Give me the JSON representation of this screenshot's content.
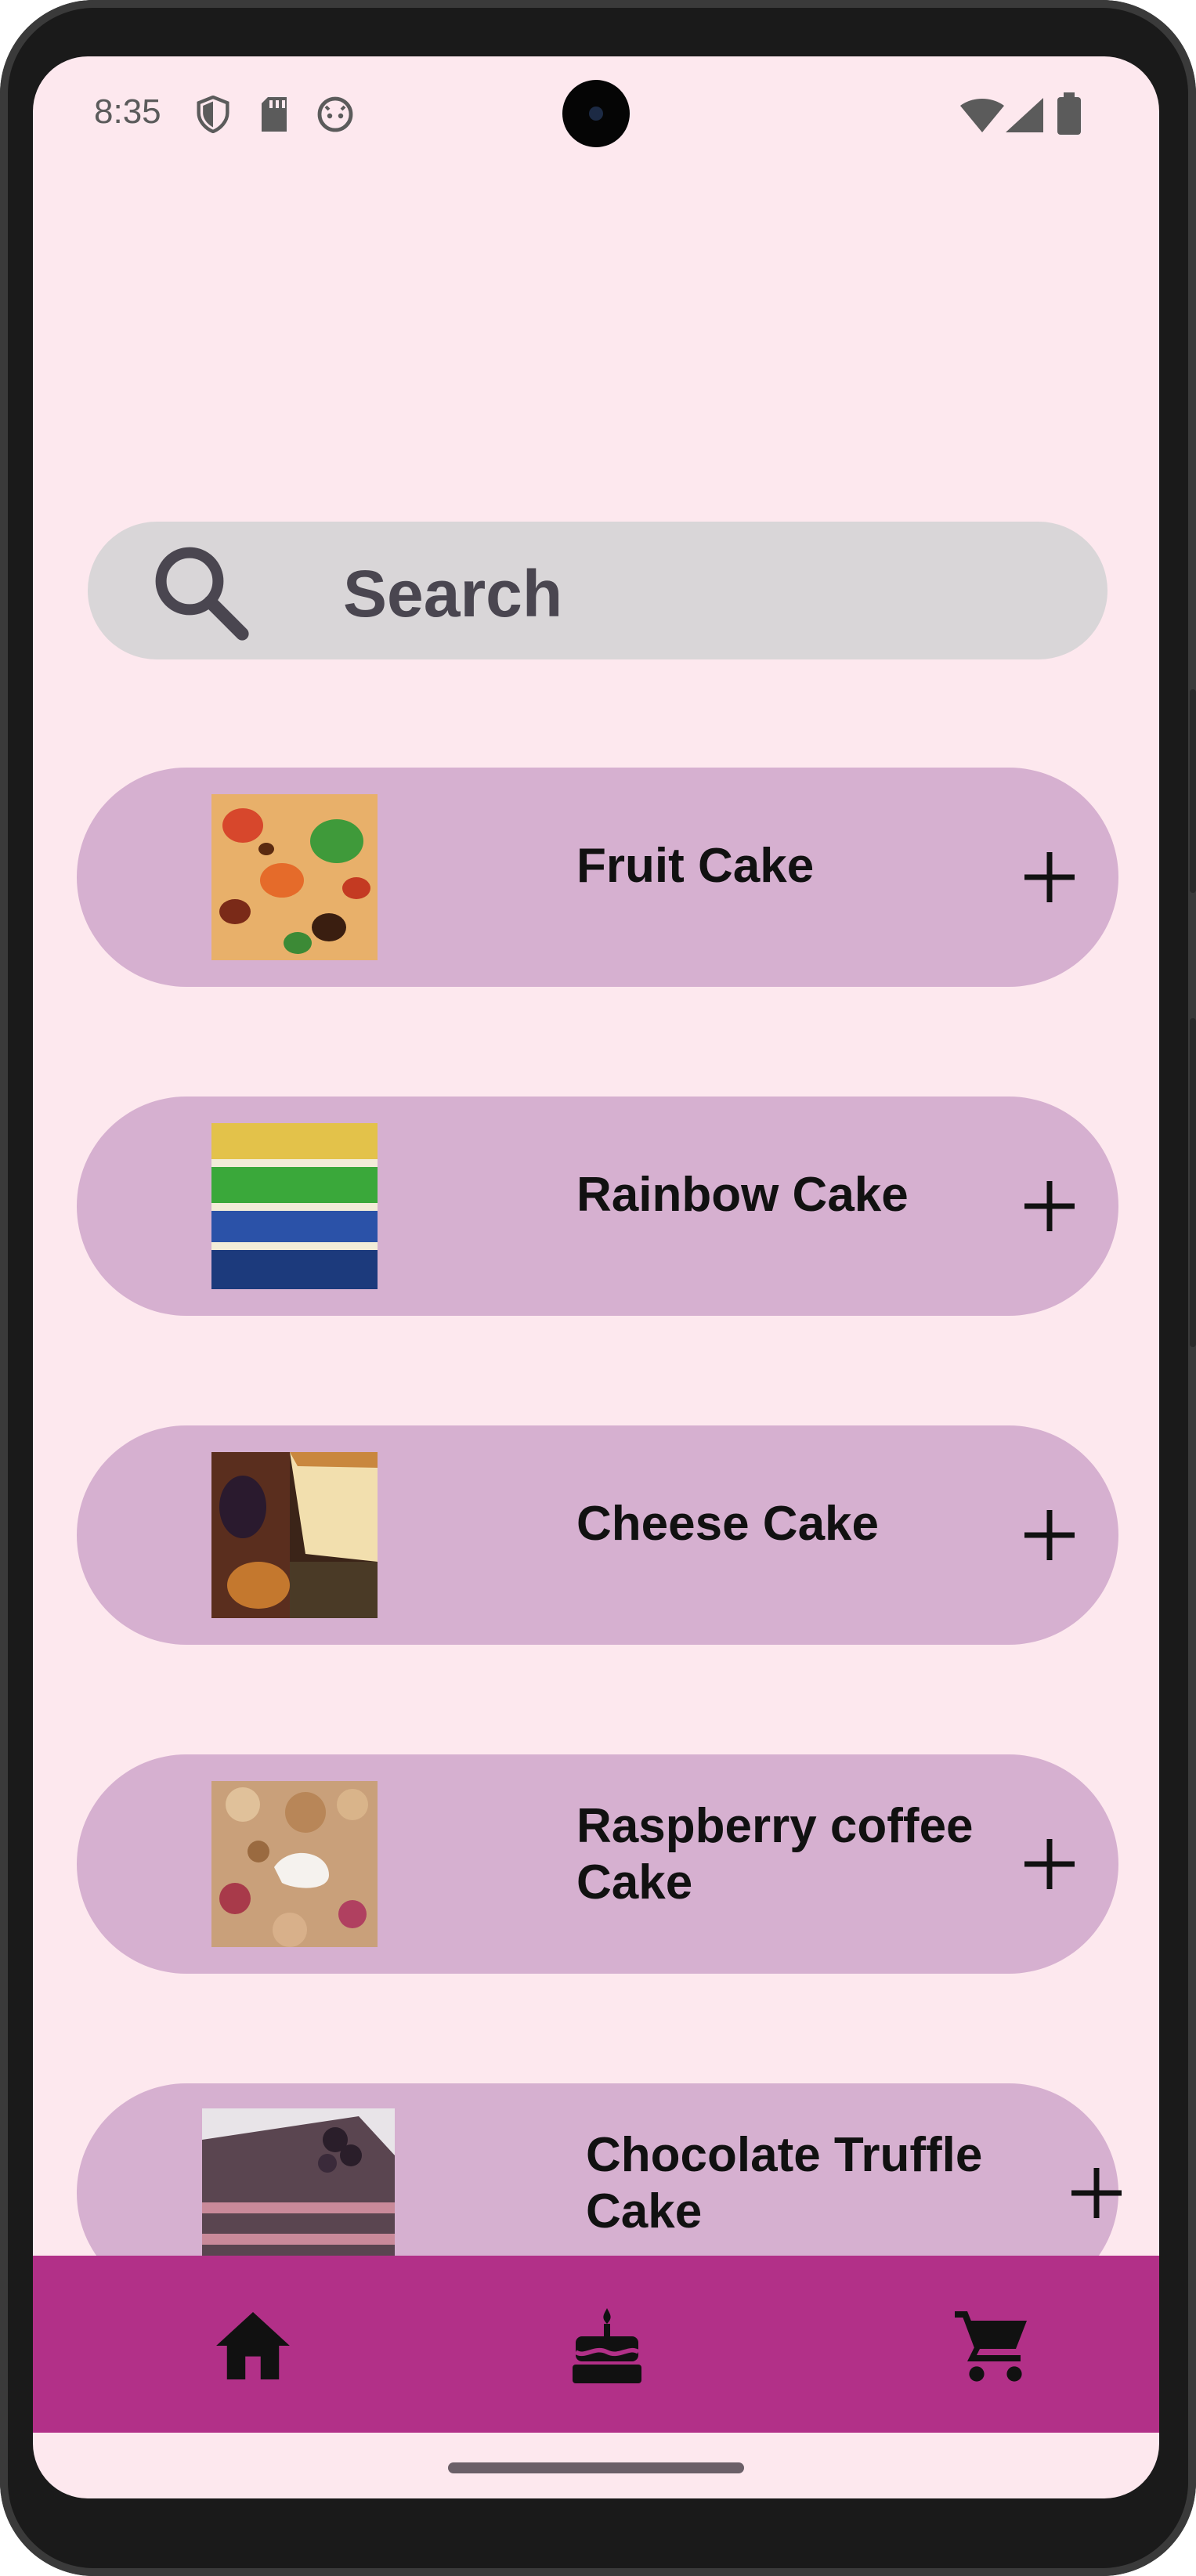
{
  "status_bar": {
    "time": "8:35",
    "left_icons": [
      "shield-icon",
      "sd-card-icon",
      "android-head-icon"
    ],
    "right_icons": [
      "wifi-icon",
      "signal-icon",
      "battery-icon"
    ]
  },
  "search": {
    "placeholder": "Search",
    "icon": "search-icon"
  },
  "cakes": [
    {
      "name": "Fruit Cake",
      "add_icon": "plus-icon"
    },
    {
      "name": "Rainbow Cake",
      "add_icon": "plus-icon"
    },
    {
      "name": "Cheese Cake",
      "add_icon": "plus-icon"
    },
    {
      "name": "Raspberry coffee Cake",
      "add_icon": "plus-icon"
    },
    {
      "name": "Chocolate Truffle Cake",
      "add_icon": "plus-icon"
    }
  ],
  "bottom_nav": {
    "items": [
      "home-icon",
      "cake-icon",
      "cart-icon"
    ],
    "color": "#b23088"
  },
  "colors": {
    "background": "#fde8ee",
    "card": "#d6b0d0",
    "search_bg": "#d9d6d8"
  }
}
